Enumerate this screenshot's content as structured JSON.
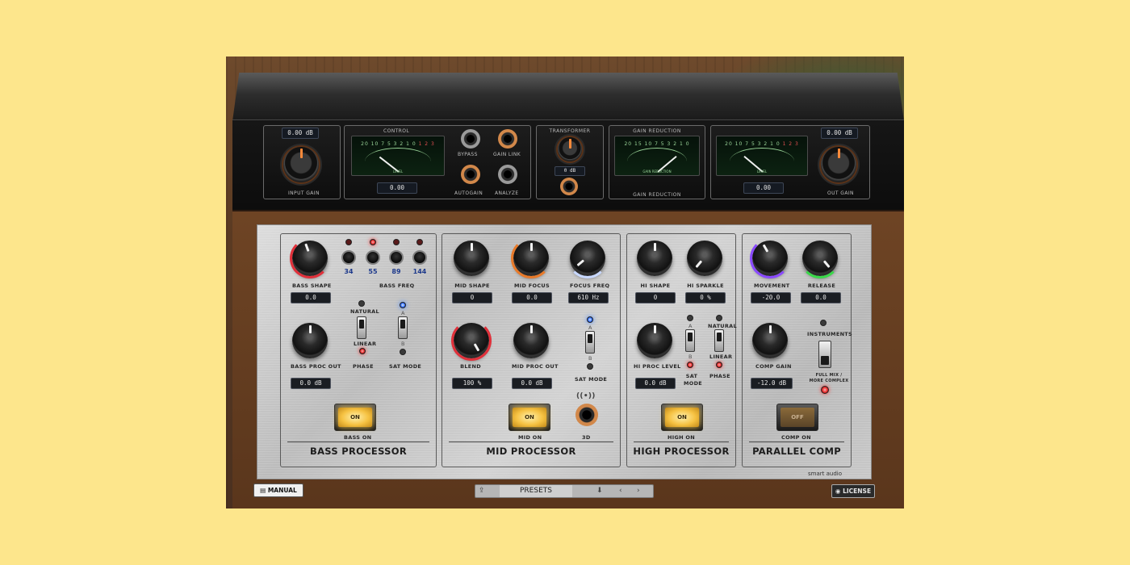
{
  "rack": {
    "input_gain_value": "0.00 dB",
    "input_gain_label": "INPUT GAIN",
    "control_title": "CONTROL",
    "control_value": "0.00",
    "bypass_label": "BYPASS",
    "gain_link_label": "GAIN LINK",
    "autogain_label": "AUTOGAIN",
    "analyze_label": "ANALYZE",
    "transformer_title": "TRANSFORMER",
    "transformer_value": "0 dB",
    "gain_reduction_title": "GAIN REDUCTION",
    "gain_reduction_label": "GAIN REDUCTION",
    "out_gain_value": "0.00 dB",
    "out_display_value": "0.00",
    "out_gain_label": "OUT GAIN"
  },
  "bass": {
    "title": "BASS PROCESSOR",
    "shape_label": "BASS SHAPE",
    "shape_value": "0.0",
    "freq_label": "BASS FREQ",
    "freqs": [
      "34",
      "55",
      "89",
      "144"
    ],
    "natural_label": "NATURAL",
    "linear_label": "LINEAR",
    "phase_label": "PHASE",
    "a_label": "A",
    "b_label": "B",
    "sat_mode_label": "SAT MODE",
    "proc_out_label": "BASS PROC OUT",
    "proc_out_value": "0.0 dB",
    "on_button": "ON",
    "on_label": "BASS ON"
  },
  "mid": {
    "title": "MID PROCESSOR",
    "shape_label": "MID SHAPE",
    "shape_value": "0",
    "focus_label": "MID FOCUS",
    "focus_value": "0.0",
    "focus_freq_label": "FOCUS FREQ",
    "focus_freq_value": "610 Hz",
    "blend_label": "BLEND",
    "blend_value": "100 %",
    "proc_out_label": "MID PROC OUT",
    "proc_out_value": "0.0 dB",
    "a_label": "A",
    "b_label": "B",
    "sat_mode_label": "SAT MODE",
    "on_button": "ON",
    "on_label": "MID ON",
    "threed_label": "3D"
  },
  "high": {
    "title": "HIGH PROCESSOR",
    "shape_label": "HI SHAPE",
    "shape_value": "0",
    "sparkle_label": "HI SPARKLE",
    "sparkle_value": "0 %",
    "proc_level_label": "HI PROC LEVEL",
    "proc_level_value": "0.0 dB",
    "a_label": "A",
    "b_label": "B",
    "sat_mode_label": "SAT MODE",
    "natural_label": "NATURAL",
    "linear_label": "LINEAR",
    "phase_label": "PHASE",
    "on_button": "ON",
    "on_label": "HIGH ON"
  },
  "comp": {
    "title": "PARALLEL COMP",
    "movement_label": "MOVEMENT",
    "movement_value": "-20.0",
    "release_label": "RELEASE",
    "release_value": "0.0",
    "instruments_label": "INSTRUMENTS",
    "full_mix_label": "FULL MIX / MORE COMPLEX",
    "comp_gain_label": "COMP GAIN",
    "comp_gain_value": "-12.0 dB",
    "on_button": "OFF",
    "on_label": "COMP ON"
  },
  "bottom": {
    "manual": "MANUAL",
    "presets": "PRESETS",
    "license": "LICENSE",
    "brand": "smart audio"
  },
  "colors": {
    "background": "#fde68c",
    "led_on": "#e02020",
    "led_blue": "#2a6aff",
    "button_glow": "#f6c242"
  }
}
